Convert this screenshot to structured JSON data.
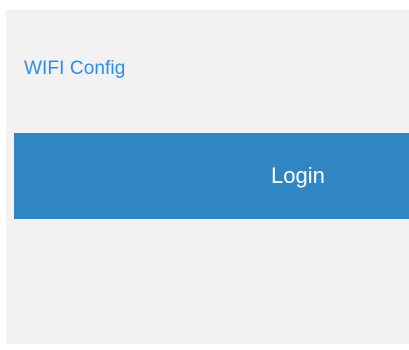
{
  "links": {
    "wifi_config": "WIFI Config"
  },
  "buttons": {
    "login": "Login"
  },
  "colors": {
    "panel_background": "#f2f2f2",
    "link_color": "#2e8ee6",
    "button_background": "#2f86c3",
    "button_text": "#ffffff"
  }
}
